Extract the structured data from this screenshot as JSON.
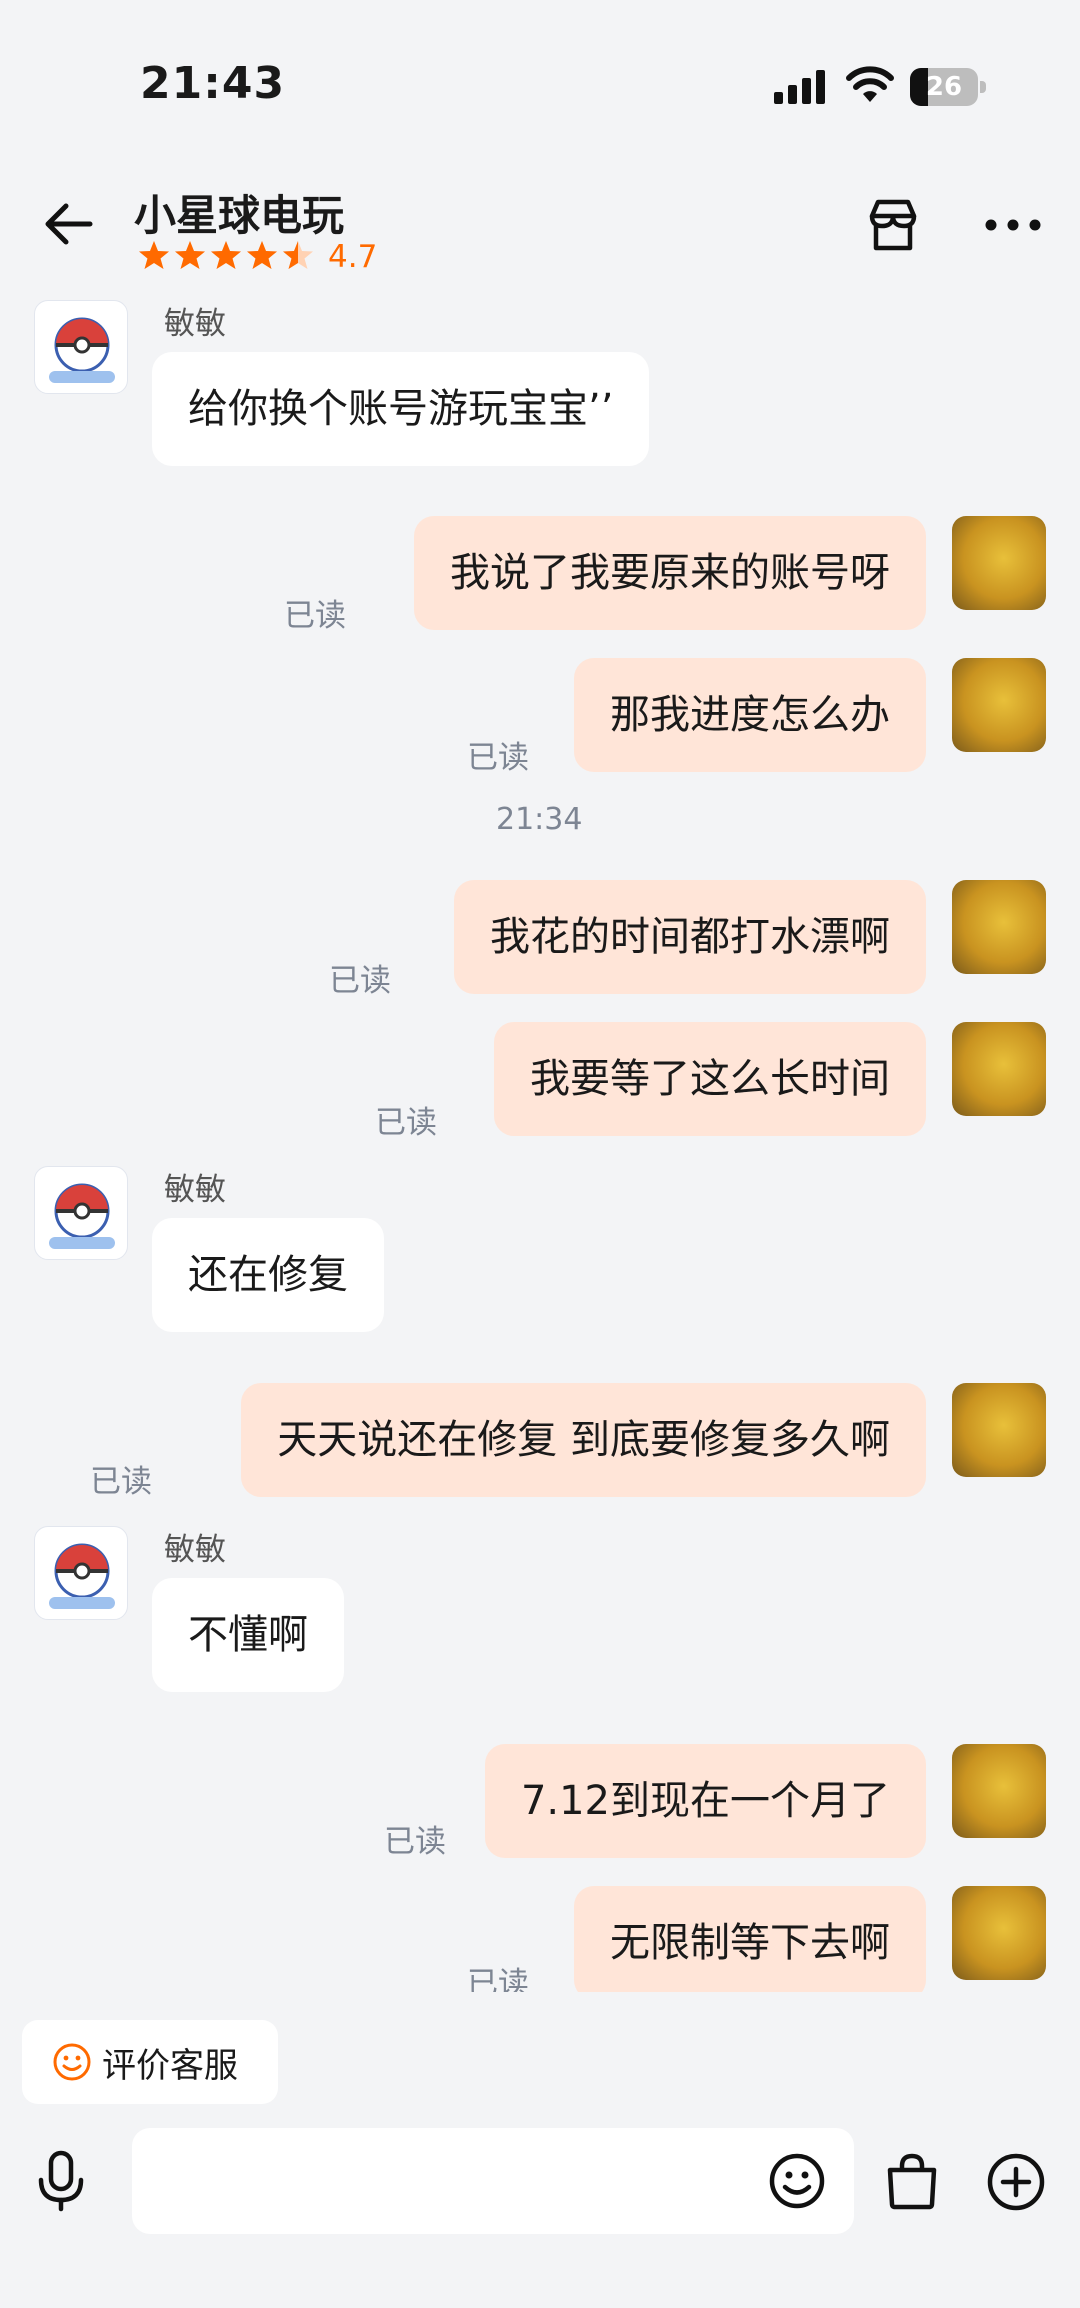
{
  "status_bar": {
    "time": "21:43",
    "battery": "26"
  },
  "header": {
    "title": "小星球电玩",
    "rating": "4.7",
    "rating_stars": 4.5
  },
  "messages": [
    {
      "kind": "in",
      "sender": "敏敏",
      "text": "给你换个账号游玩宝宝’’"
    },
    {
      "kind": "out",
      "text": "我说了我要原来的账号呀",
      "status": "已读"
    },
    {
      "kind": "out",
      "text": "那我进度怎么办",
      "status": "已读"
    },
    {
      "kind": "time",
      "text": "21:34"
    },
    {
      "kind": "out",
      "text": "我花的时间都打水漂啊",
      "status": "已读"
    },
    {
      "kind": "out",
      "text": "我要等了这么长时间",
      "status": "已读"
    },
    {
      "kind": "in",
      "sender": "敏敏",
      "text": "还在修复"
    },
    {
      "kind": "out",
      "text": "天天说还在修复 到底要修复多久啊",
      "status": "已读"
    },
    {
      "kind": "in",
      "sender": "敏敏",
      "text": "不懂啊"
    },
    {
      "kind": "out",
      "text": "7.12到现在一个月了",
      "status": "已读"
    },
    {
      "kind": "out",
      "text": "无限制等下去啊",
      "status": "已读"
    }
  ],
  "bottom": {
    "rate_service_label": "评价客服"
  },
  "colors": {
    "accent": "#ff6a00",
    "outgoing_bubble": "#ffe5d8",
    "incoming_bubble": "#ffffff",
    "background": "#f3f4f6"
  },
  "icons": [
    "back-arrow-icon",
    "store-icon",
    "more-icon",
    "smile-icon",
    "mic-icon",
    "emoji-icon",
    "shopping-bag-icon",
    "plus-icon"
  ]
}
